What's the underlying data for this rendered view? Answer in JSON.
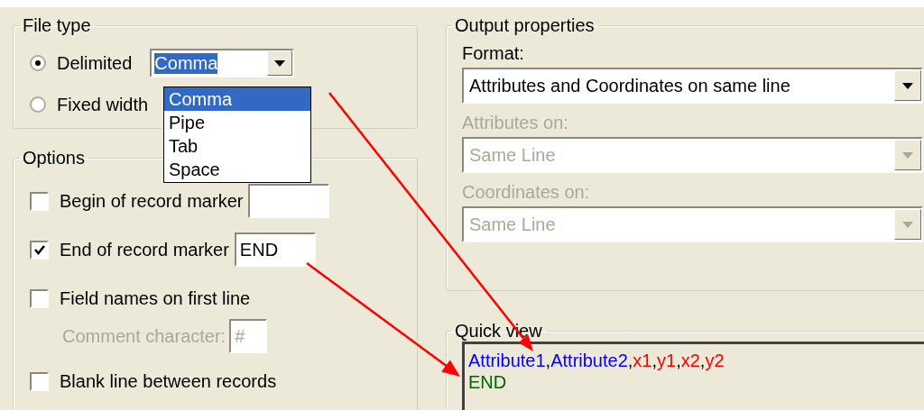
{
  "file_type": {
    "title": "File type",
    "options": [
      {
        "label": "Delimited",
        "selected": true
      },
      {
        "label": "Fixed width",
        "selected": false
      }
    ],
    "delimiter": {
      "value": "Comma",
      "expanded": true,
      "list": [
        {
          "label": "Comma",
          "selected": true
        },
        {
          "label": "Pipe",
          "selected": false
        },
        {
          "label": "Tab",
          "selected": false
        },
        {
          "label": "Space",
          "selected": false
        }
      ]
    }
  },
  "options": {
    "title": "Options",
    "items": [
      {
        "kind": "check-field",
        "label": "Begin of record marker",
        "checked": false
      },
      {
        "kind": "check-field",
        "label": "End of record marker",
        "checked": true,
        "value": "END"
      },
      {
        "kind": "check",
        "label": "Field names on first line",
        "checked": false
      },
      {
        "kind": "field",
        "label": "Comment character:",
        "value": "#",
        "disabled": true
      },
      {
        "kind": "check",
        "label": "Blank line between records",
        "checked": false
      }
    ]
  },
  "output_properties": {
    "title": "Output properties",
    "fields": [
      {
        "label": "Format:",
        "value": "Attributes and Coordinates on same line",
        "disabled": false
      },
      {
        "label": "Attributes on:",
        "value": "Same Line",
        "disabled": true
      },
      {
        "label": "Coordinates on:",
        "value": "Same Line",
        "disabled": true
      }
    ]
  },
  "quick_view": {
    "title": "Quick view",
    "lines": [
      [
        {
          "text": "Attribute1",
          "color": "#0000ff"
        },
        {
          "text": ","
        },
        {
          "text": "Attribute2",
          "color": "#0000ff"
        },
        {
          "text": ","
        },
        {
          "text": "x1",
          "color": "#ff0000"
        },
        {
          "text": ","
        },
        {
          "text": "y1",
          "color": "#ff0000"
        },
        {
          "text": ","
        },
        {
          "text": "x2",
          "color": "#ff0000"
        },
        {
          "text": ","
        },
        {
          "text": "y2",
          "color": "#ff0000"
        }
      ],
      [
        {
          "text": "END",
          "color": "#006400"
        }
      ]
    ]
  }
}
